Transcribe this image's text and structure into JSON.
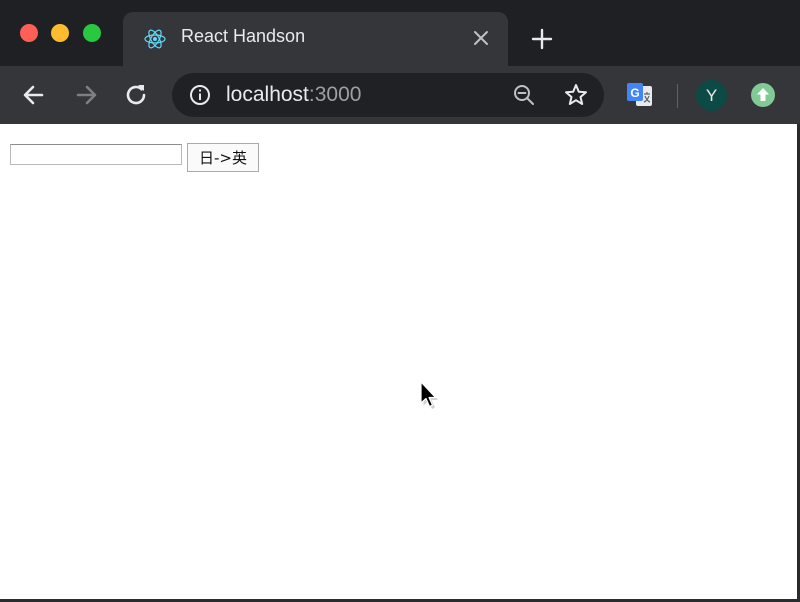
{
  "window": {
    "traffic_lights": [
      "close",
      "minimize",
      "maximize"
    ]
  },
  "tab": {
    "title": "React Handson",
    "icon": "react-icon"
  },
  "toolbar": {
    "url_host": "localhost",
    "url_port": ":3000",
    "avatar_initial": "Y"
  },
  "page": {
    "input_value": "",
    "button_label": "日->英"
  },
  "colors": {
    "chrome_dark": "#1f2023",
    "chrome_tab": "#35363a",
    "omnibox": "#202124",
    "avatar": "#0b4a45",
    "update_green": "#81c995",
    "react_blue": "#61dafb"
  }
}
